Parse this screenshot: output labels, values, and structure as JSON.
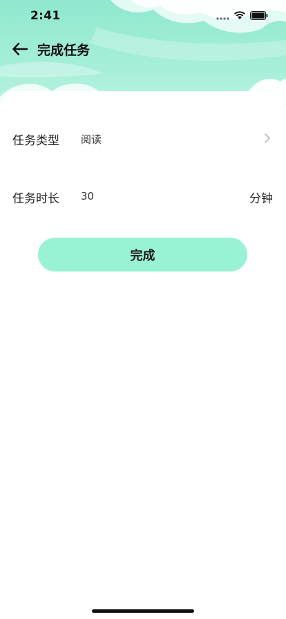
{
  "status_bar": {
    "time": "2:41"
  },
  "nav": {
    "title": "完成任务",
    "back_icon": "arrow-left-icon"
  },
  "form": {
    "task_type": {
      "label": "任务类型",
      "value": "阅读",
      "icon": "chevron-right-icon"
    },
    "task_duration": {
      "label": "任务时长",
      "value": "30",
      "unit": "分钟"
    }
  },
  "submit": {
    "label": "完成"
  },
  "colors": {
    "sky_top": "#8fe8cf",
    "button_bg": "#9af2d5",
    "cloud": "#ffffff"
  }
}
